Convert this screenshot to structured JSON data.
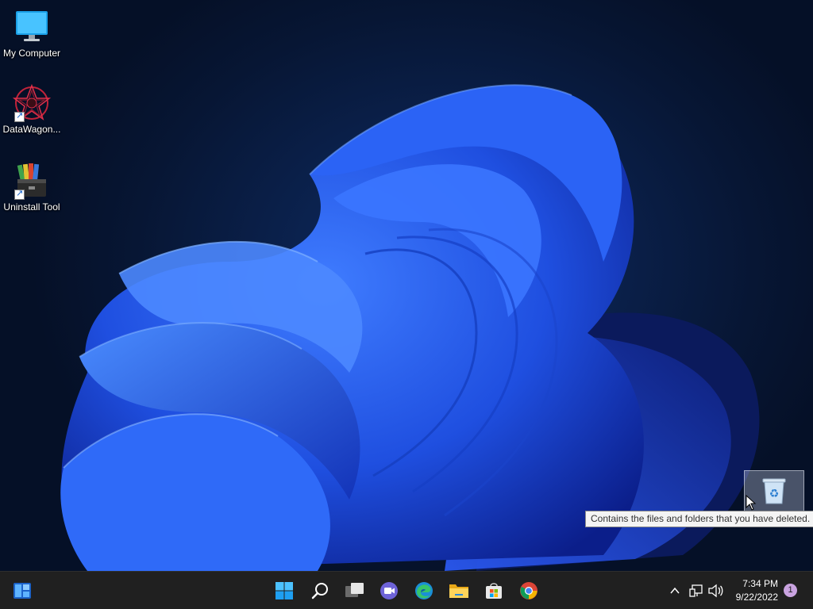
{
  "desktop": {
    "icons": [
      {
        "label": "My Computer",
        "icon": "computer-monitor-icon"
      },
      {
        "label": "DataWagon...",
        "icon": "datawagon-icon"
      },
      {
        "label": "Uninstall Tool",
        "icon": "uninstall-tool-icon"
      }
    ],
    "recycle_bin": {
      "label": "Recycle Bin",
      "icon": "recycle-bin-icon"
    },
    "tooltip": "Contains the files and folders that you have deleted."
  },
  "taskbar": {
    "widgets_icon": "widgets-icon",
    "pinned": [
      {
        "name": "start",
        "icon": "windows-start-icon"
      },
      {
        "name": "search",
        "icon": "search-icon"
      },
      {
        "name": "task-view",
        "icon": "task-view-icon"
      },
      {
        "name": "teams-chat",
        "icon": "chat-video-icon"
      },
      {
        "name": "edge",
        "icon": "edge-browser-icon"
      },
      {
        "name": "file-explorer",
        "icon": "folder-icon"
      },
      {
        "name": "microsoft-store",
        "icon": "store-icon"
      },
      {
        "name": "chrome",
        "icon": "chrome-icon"
      }
    ],
    "tray": {
      "time": "7:34 PM",
      "date": "9/22/2022",
      "notification_count": "1"
    }
  },
  "colors": {
    "taskbar_bg": "#202020",
    "wallpaper_blue": "#1f4fe0",
    "accent": "#3b8ee8"
  }
}
